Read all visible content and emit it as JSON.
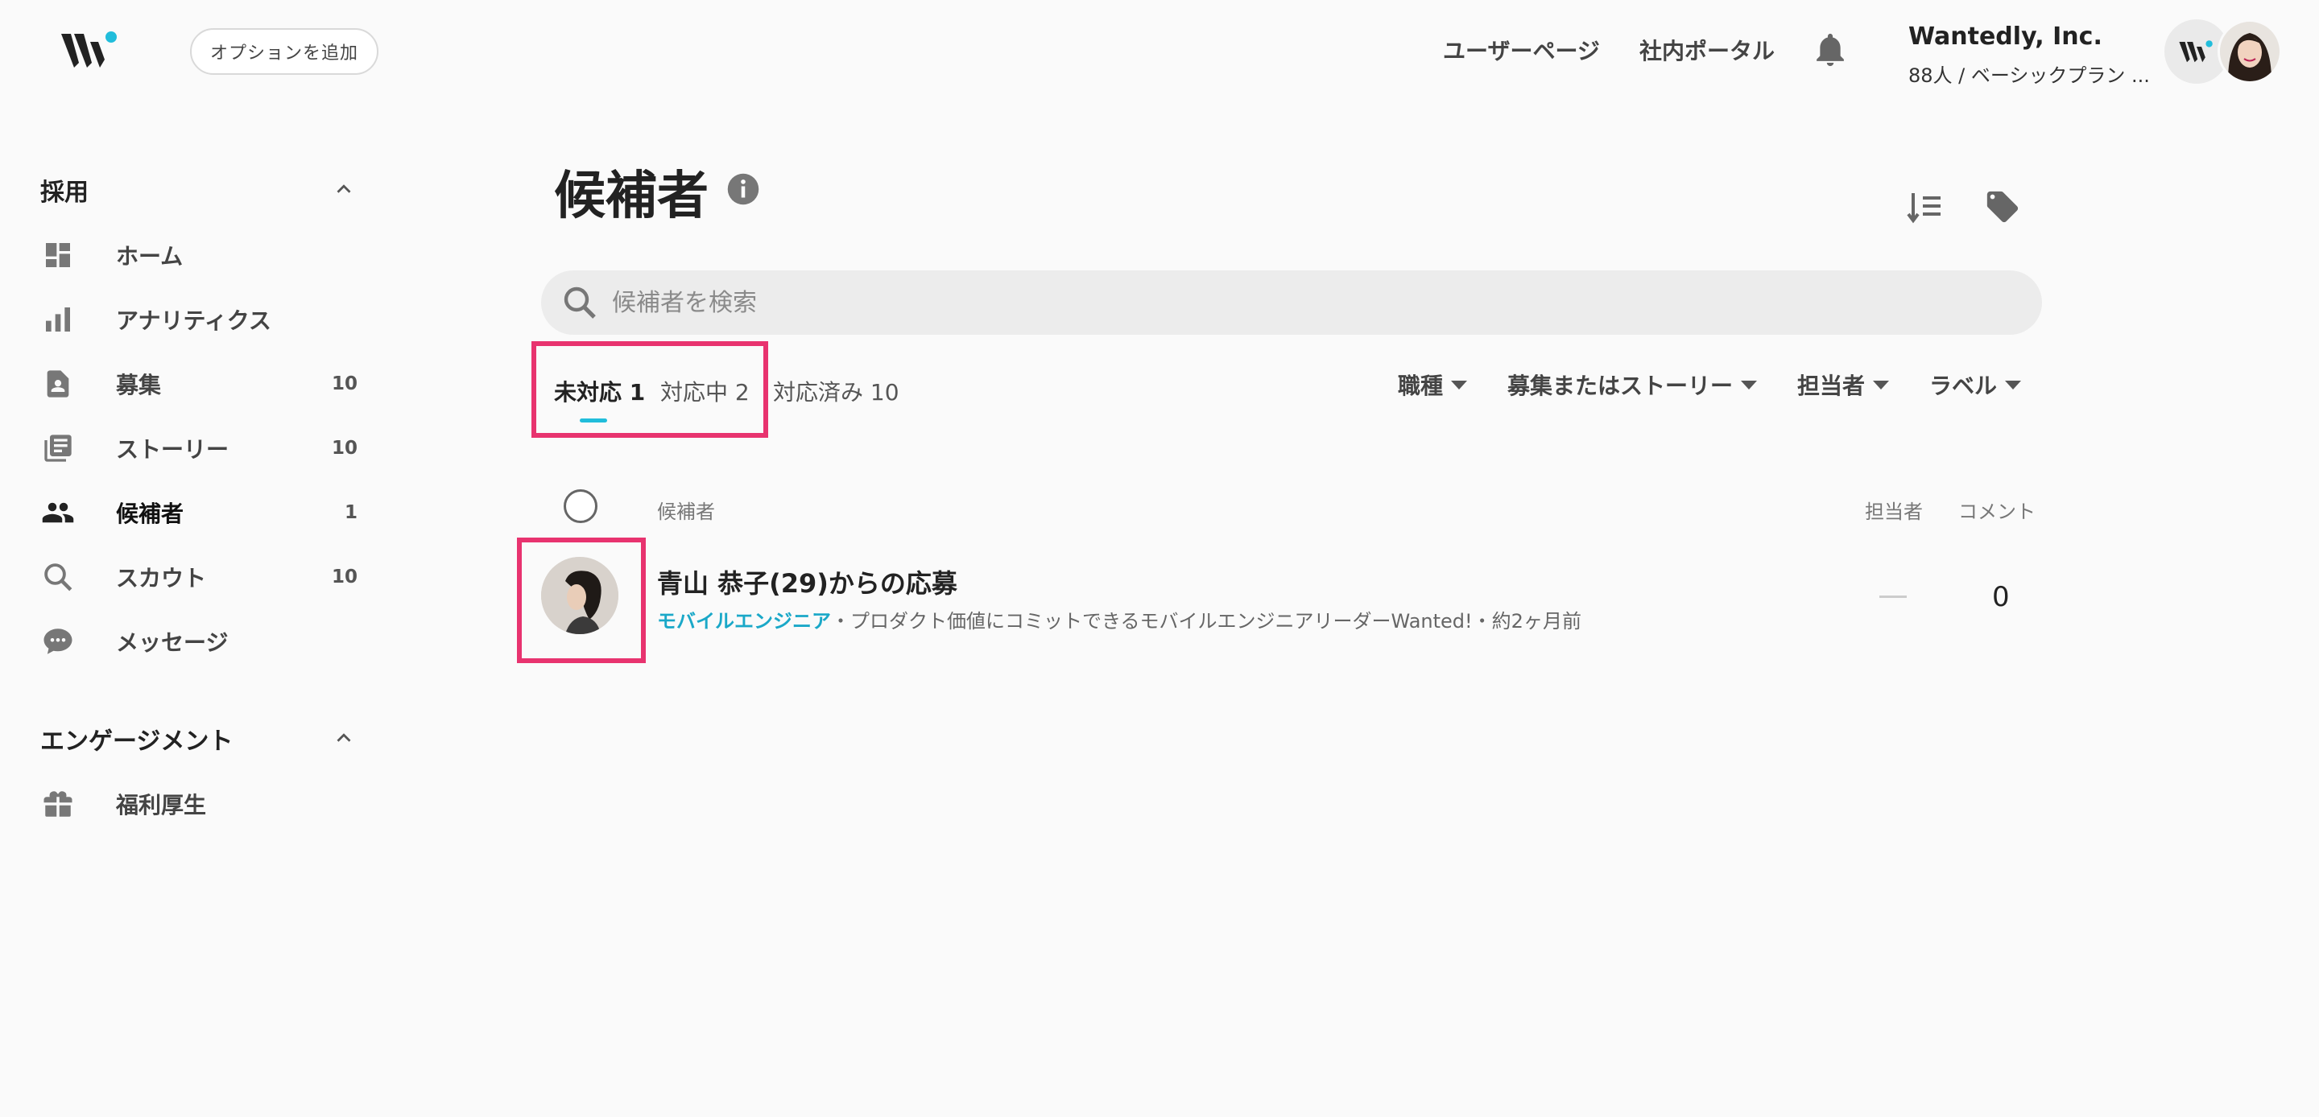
{
  "header": {
    "add_option_label": "オプションを追加",
    "links": [
      "ユーザーページ",
      "社内ポータル"
    ],
    "company_name": "Wantedly, Inc.",
    "company_plan": "88人 / ベーシックプラン ..."
  },
  "sidebar": {
    "sections": [
      {
        "title": "採用",
        "items": [
          {
            "label": "ホーム",
            "count": "",
            "icon": "dashboard-icon"
          },
          {
            "label": "アナリティクス",
            "count": "",
            "icon": "bar-chart-icon"
          },
          {
            "label": "募集",
            "count": "10",
            "icon": "job-post-icon"
          },
          {
            "label": "ストーリー",
            "count": "10",
            "icon": "stories-icon"
          },
          {
            "label": "候補者",
            "count": "1",
            "icon": "people-icon",
            "active": true
          },
          {
            "label": "スカウト",
            "count": "10",
            "icon": "search-icon"
          },
          {
            "label": "メッセージ",
            "count": "",
            "icon": "chat-bubble-icon"
          }
        ]
      },
      {
        "title": "エンゲージメント",
        "items": [
          {
            "label": "福利厚生",
            "count": "",
            "icon": "gift-icon"
          }
        ]
      }
    ]
  },
  "main": {
    "title": "候補者",
    "search_placeholder": "候補者を検索",
    "tabs": [
      {
        "label": "未対応 1",
        "active": true
      },
      {
        "label": "対応中 2",
        "active": false
      },
      {
        "label": "対応済み 10",
        "active": false
      }
    ],
    "filters": [
      "職種",
      "募集またはストーリー",
      "担当者",
      "ラベル"
    ],
    "columns": {
      "candidate": "候補者",
      "assignee": "担当者",
      "comment": "コメント"
    },
    "candidates": [
      {
        "name": "青山 恭子(29)からの応募",
        "job": "モバイルエンジニア",
        "sep1": "・",
        "post": "プロダクト価値にコミットできるモバイルエンジニアリーダーWanted!",
        "sep2": "・",
        "time": "約2ヶ月前",
        "comments": "0"
      }
    ]
  },
  "colors": {
    "accent": "#21bddb",
    "highlight": "#e8336f",
    "job_link": "#1aa8c8"
  }
}
